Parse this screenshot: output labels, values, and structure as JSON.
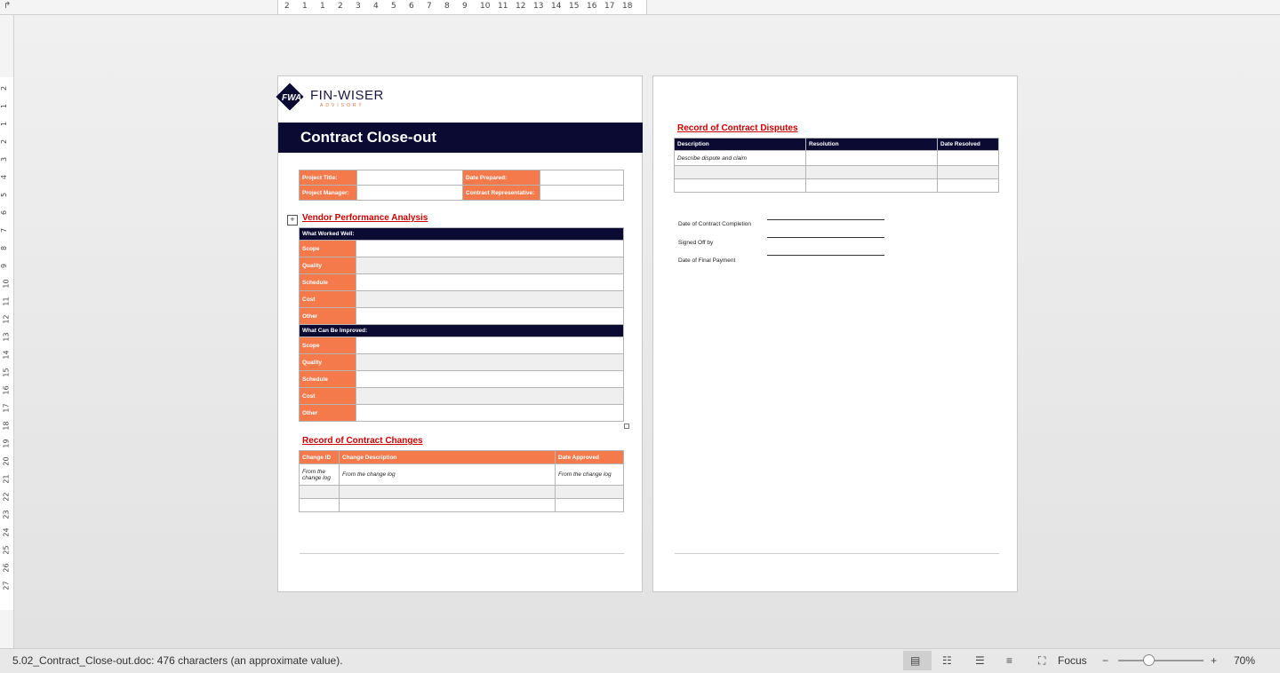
{
  "ruler": {
    "corner": "↱",
    "h_ticks": [
      "2",
      "1",
      "1",
      "2",
      "3",
      "4",
      "5",
      "6",
      "7",
      "8",
      "9",
      "10",
      "11",
      "12",
      "13",
      "14",
      "15",
      "16",
      "17",
      "18"
    ],
    "v_ticks": [
      "2",
      "1",
      "1",
      "2",
      "3",
      "4",
      "5",
      "6",
      "7",
      "8",
      "9",
      "10",
      "11",
      "12",
      "13",
      "14",
      "15",
      "16",
      "17",
      "18",
      "19",
      "20",
      "21",
      "22",
      "23",
      "24",
      "25",
      "26",
      "27"
    ]
  },
  "page1": {
    "logo": {
      "mark": "FWA",
      "name": "FIN-WISER",
      "sub": "ADVISORY"
    },
    "title": "Contract Close-out",
    "info": {
      "project_title": "Project Title:",
      "date_prepared": "Date Prepared:",
      "project_manager": "Project Manager:",
      "contract_rep": "Contract Representative:"
    },
    "vendor_heading": "Vendor Performance Analysis",
    "worked_well": "What Worked Well:",
    "improved": "What Can Be Improved:",
    "rows": [
      "Scope",
      "Quality",
      "Schedule",
      "Cost",
      "Other"
    ],
    "changes_heading": "Record of Contract Changes",
    "changes_headers": [
      "Change ID",
      "Change Description",
      "Date Approved"
    ],
    "changes_row": [
      "From the change log",
      "From the change log",
      "From the change log"
    ]
  },
  "page2": {
    "disputes_heading": "Record of Contract Disputes",
    "disputes_headers": [
      "Description",
      "Resolution",
      "Date Resolved"
    ],
    "disputes_row": "Describe dispute and claim",
    "signoff": [
      "Date of Contract Completion",
      "Signed Off by",
      "Date of Final Payment"
    ]
  },
  "status": {
    "doc_info": "5.02_Contract_Close-out.doc: 476 characters (an approximate value).",
    "focus": "Focus",
    "zoom": "70%"
  }
}
